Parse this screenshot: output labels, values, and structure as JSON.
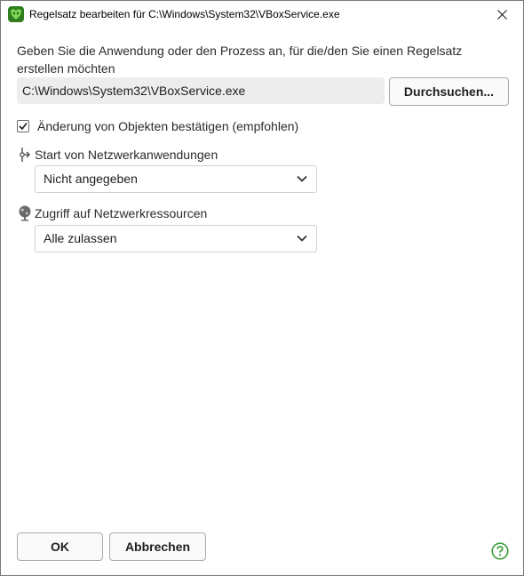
{
  "window": {
    "title": "Regelsatz bearbeiten für C:\\Windows\\System32\\VBoxService.exe"
  },
  "prompt": {
    "text": "Geben Sie die Anwendung oder den Prozess an, für die/den Sie einen Regelsatz erstellen möchten"
  },
  "path_field": {
    "value": "C:\\Windows\\System32\\VBoxService.exe"
  },
  "browse_button": {
    "label": "Durchsuchen..."
  },
  "confirm_checkbox": {
    "label": "Änderung von Objekten bestätigen (empfohlen)",
    "checked": true
  },
  "network_apps": {
    "label": "Start von Netzwerkanwendungen",
    "icon": "network-launch-icon",
    "selected": "Nicht angegeben"
  },
  "network_resources": {
    "label": "Zugriff auf Netzwerkressourcen",
    "icon": "globe-icon",
    "selected": "Alle zulassen"
  },
  "footer": {
    "ok_label": "OK",
    "cancel_label": "Abbrechen",
    "help_icon": "help-icon"
  },
  "colors": {
    "brand_green": "#2f7d1d",
    "help_green": "#3aa13a",
    "field_background": "#ededed"
  }
}
